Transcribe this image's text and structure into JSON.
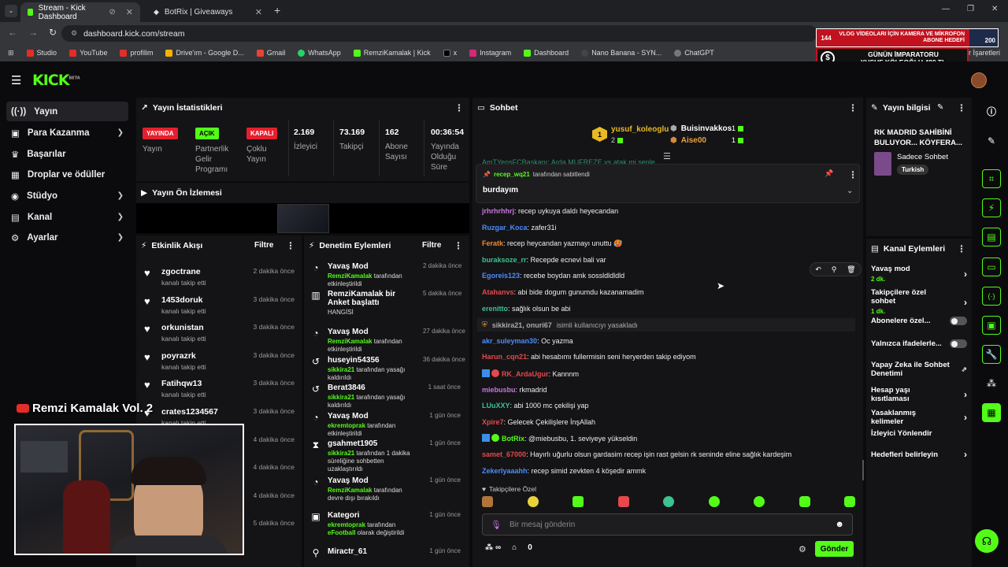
{
  "browser": {
    "tabs": [
      {
        "label": "Stream - Kick Dashboard"
      },
      {
        "label": "BotRix | Giveaways"
      }
    ],
    "url": "dashboard.kick.com/stream",
    "bookmarks": [
      "Studio",
      "YouTube",
      "profilim",
      "Drive'ım - Google D...",
      "Gmail",
      "WhatsApp",
      "RemziKamalak | Kick",
      "x",
      "Instagram",
      "Dashboard",
      "Nano Banana - SYN...",
      "ChatGPT"
    ],
    "bookmarks_right": "er İşaretleri"
  },
  "overlay": {
    "count": "144",
    "goal_text": "VLOG VİDEOLARI İÇİN KAMERA VE MİKROFON ABONE HEDEFİ",
    "goal_number": "200",
    "emperor_title": "GÜNÜN İMPARATORU",
    "emperor_name": "YUSUF KÖLEOĞLU 480 TL",
    "streamer_name": "Remzi Kamalak Vol. 2"
  },
  "brand": {
    "logo": "KICK",
    "beta": "BETA"
  },
  "sidebar": {
    "items": [
      {
        "label": "Yayın",
        "icon": "broadcast-icon",
        "expand": false
      },
      {
        "label": "Para Kazanma",
        "icon": "money-icon",
        "expand": true
      },
      {
        "label": "Başarılar",
        "icon": "trophy-icon",
        "expand": false
      },
      {
        "label": "Droplar ve ödüller",
        "icon": "gift-icon",
        "expand": false
      },
      {
        "label": "Stüdyo",
        "icon": "studio-icon",
        "expand": true
      },
      {
        "label": "Kanal",
        "icon": "channel-icon",
        "expand": true
      },
      {
        "label": "Ayarlar",
        "icon": "gear-icon",
        "expand": true
      }
    ]
  },
  "stats": {
    "title": "Yayın İstatistikleri",
    "items": [
      {
        "badge": "YAYINDA",
        "badge_color": "#e5202e",
        "label": "Yayın"
      },
      {
        "badge": "AÇIK",
        "badge_color": "#53fc18",
        "label": "Partnerlik Gelir Programı"
      },
      {
        "badge": "KAPALI",
        "badge_color": "#e5202e",
        "label": "Çoklu Yayın"
      },
      {
        "value": "2.169",
        "label": "İzleyici"
      },
      {
        "value": "73.169",
        "label": "Takipçi"
      },
      {
        "value": "162",
        "label": "Abone Sayısı"
      },
      {
        "value": "00:36:54",
        "label": "Yayında Olduğu Süre"
      }
    ]
  },
  "preview": {
    "title": "Yayın Ön İzlemesi"
  },
  "activity": {
    "title": "Etkinlik Akışı",
    "filter": "Filtre",
    "items": [
      {
        "name": "zgoctrane",
        "sub": "kanalı takip etti",
        "time": "2 dakika önce"
      },
      {
        "name": "1453doruk",
        "sub": "kanalı takip etti",
        "time": "3 dakika önce"
      },
      {
        "name": "orkunistan",
        "sub": "kanalı takip etti",
        "time": "3 dakika önce"
      },
      {
        "name": "poyrazrk",
        "sub": "kanalı takip etti",
        "time": "3 dakika önce"
      },
      {
        "name": "Fatihqw13",
        "sub": "kanalı takip etti",
        "time": "3 dakika önce"
      },
      {
        "name": "crates1234567",
        "sub": "kanalı takip etti",
        "time": "3 dakika önce"
      },
      {
        "name": "",
        "sub": "",
        "time": "4 dakika önce"
      },
      {
        "name": "",
        "sub": "",
        "time": "4 dakika önce"
      },
      {
        "name": "",
        "sub": "",
        "time": "4 dakika önce"
      },
      {
        "name": "",
        "sub": "",
        "time": "5 dakika önce"
      }
    ]
  },
  "moderation": {
    "title": "Denetim Eylemleri",
    "filter": "Filtre",
    "items": [
      {
        "icon": "slow-mode-icon",
        "title": "Yavaş Mod",
        "user": "RemziKamalak",
        "action": "tarafından etkinleştirildi",
        "time": "2 dakika önce"
      },
      {
        "icon": "poll-icon",
        "title": "RemziKamalak bir Anket başlattı",
        "user": "",
        "action": "HANGİSİ",
        "time": "5 dakika önce"
      },
      {
        "icon": "slow-mode-icon",
        "title": "Yavaş Mod",
        "user": "RemziKamalak",
        "action": "tarafından etkinleştirildi",
        "time": "27 dakika önce"
      },
      {
        "icon": "unban-icon",
        "title": "huseyin54356",
        "user": "sikkira21",
        "action": "tarafından yasağı kaldırıldı",
        "time": "36 dakika önce"
      },
      {
        "icon": "unban-icon",
        "title": "Berat3846",
        "user": "sikkira21",
        "action": "tarafından yasağı kaldırıldı",
        "time": "1 saat önce"
      },
      {
        "icon": "slow-mode-icon",
        "title": "Yavaş Mod",
        "user": "ekremtoprak",
        "action": "tarafından etkinleştirildi",
        "time": "1 gün önce"
      },
      {
        "icon": "timeout-icon",
        "title": "gsahmet1905",
        "user": "sikkira21",
        "action": "tarafından 1 dakika süreliğine sohbetten uzaklaştırıldı",
        "time": "1 gün önce"
      },
      {
        "icon": "slow-mode-icon",
        "title": "Yavaş Mod",
        "user": "RemziKamalak",
        "action": "tarafından devre dışı bırakıldı",
        "time": "1 gün önce"
      },
      {
        "icon": "category-icon",
        "title": "Kategori",
        "user": "ekremtoprak",
        "action": "tarafından",
        "extra": "eFootball",
        "extra2": "olarak değiştirildi",
        "time": "1 gün önce"
      },
      {
        "icon": "user-icon",
        "title": "Miractr_61",
        "user": "",
        "action": "",
        "time": "1 gün önce"
      }
    ]
  },
  "chat": {
    "title": "Sohbet",
    "top": {
      "rank": "1",
      "name": "yusuf_koleoglu",
      "count": "2",
      "second": "Buisinvakkos",
      "second_count": "1",
      "third": "Aise00",
      "third_count": "1"
    },
    "hidden_line": "AmTYensFCBaskanı: Arda MUFREZE vs atak mi senle",
    "pinned": {
      "by": "recep_wq21",
      "by_suffix": "tarafından sabitlendi",
      "text": "burdayım"
    },
    "messages": [
      {
        "user": "jrhrhrhhrj",
        "color": "#c678dd",
        "text": ": recep uykuya daldı heyecandan"
      },
      {
        "user": "Ruzgar_Koca",
        "color": "#4a8cff",
        "text": ": zafer31i"
      },
      {
        "user": "Feratk",
        "color": "#f28c28",
        "text": ": recep heycandan yazmayı unuttu 🥵"
      },
      {
        "user": "buraksoze_rr",
        "color": "#3ec28f",
        "text": ": Recepde ecnevi bali var"
      },
      {
        "user": "Egoreis123",
        "color": "#4a8cff",
        "text": ": recebe boydan amk sossldldldld"
      },
      {
        "user": "Atahanvs",
        "color": "#e5484d",
        "text": ": abi bide dogum gunumdu kazanamadim"
      },
      {
        "user": "erenitto",
        "color": "#3ec28f",
        "text": ": sağlık olsun be abi"
      },
      {
        "user": "sikkira21, onuri67",
        "color": "#aaaaaa",
        "text": " isimli kullanıcıyı yasakladı",
        "action": true
      },
      {
        "user": "akr_suleyman30",
        "color": "#4a8cff",
        "text": ": Oc yazma"
      },
      {
        "user": "Harun_cqn21",
        "color": "#e5484d",
        "text": ": abi hesabımı fullermisin seni heryerden takip ediyom"
      },
      {
        "user": "RK_ArdaUgur",
        "color": "#e5484d",
        "text": ": Kannnm",
        "badges": true
      },
      {
        "user": "miebusbu",
        "color": "#c678dd",
        "text": ": rkmadrid"
      },
      {
        "user": "LUuXXY",
        "color": "#3ec28f",
        "text": ": abi 1000 mc çekilişi yap"
      },
      {
        "user": "Xpire7",
        "color": "#e5484d",
        "text": ": Gelecek Çekilişlere İnşAllah"
      },
      {
        "user": "BotRix",
        "color": "#53fc18",
        "text": ": @miebusbu, 1. seviyeye yükseldin",
        "badges": true
      },
      {
        "user": "samet_67000",
        "color": "#e5484d",
        "text": ": Hayırlı uğurlu olsun gardasim recep işin rast gelsin rk seninde eline sağlık kardeşim"
      },
      {
        "user": "Zekerlyaaahh",
        "color": "#4a8cff",
        "text": ": recep simid zevkten 4 köşedir ammk"
      }
    ],
    "followers_only": "Takipçilere Özel",
    "input_placeholder": "Bir mesaj gönderin",
    "points": "0",
    "send_label": "Gönder",
    "accent": "#53fc18"
  },
  "stream_info": {
    "title": "Yayın bilgisi",
    "stream_title": "RK MADRID SAHİBİNİ BULUYOR... KÖYFERA...",
    "category": "Sadece Sohbet",
    "tag": "Turkish"
  },
  "channel_actions": {
    "title": "Kanal Eylemleri",
    "items": [
      {
        "label": "Yavaş mod",
        "sub": "2 dk.",
        "type": "chevron"
      },
      {
        "label": "Takipçilere özel sohbet",
        "sub": "1 dk.",
        "type": "chevron"
      },
      {
        "label": "Abonelere özel...",
        "sub": "",
        "type": "toggle"
      },
      {
        "label": "Yalnızca ifadelerle...",
        "sub": "",
        "type": "toggle"
      },
      {
        "label": "Yapay Zeka ile Sohbet Denetimi",
        "sub": "",
        "type": "external"
      },
      {
        "label": "Hesap yaşı kısıtlaması",
        "sub": "",
        "type": "chevron"
      },
      {
        "label": "Yasaklanmış kelimeler",
        "sub": "",
        "type": "chevron"
      },
      {
        "label": "İzleyici Yönlendir",
        "sub": "",
        "type": "none"
      },
      {
        "label": "Hedefleri belirleyin",
        "sub": "",
        "type": "chevron"
      }
    ]
  }
}
